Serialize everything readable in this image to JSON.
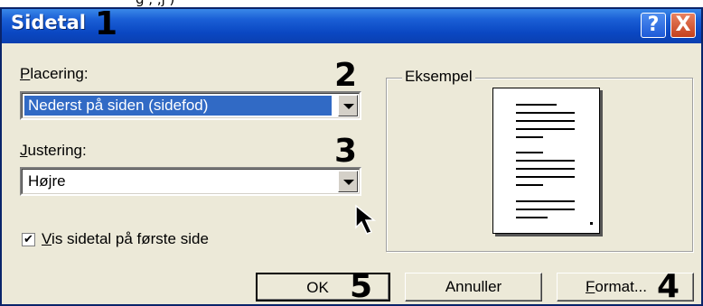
{
  "top_cut_text": "g       ,               ,j                 )",
  "window": {
    "title": "Sidetal",
    "help_label": "?",
    "close_label": "X"
  },
  "callouts": [
    "1",
    "2",
    "3",
    "4",
    "5"
  ],
  "placement": {
    "label_prefix": "P",
    "label_rest": "lacering:",
    "value": "Nederst på siden (sidefod)"
  },
  "alignment": {
    "label_prefix": "J",
    "label_rest": "ustering:",
    "value": "Højre"
  },
  "show_first_page": {
    "checked": true,
    "check_glyph": "✔",
    "label_prefix": "V",
    "label_rest": "is sidetal på første side"
  },
  "preview": {
    "legend": "Eksempel"
  },
  "buttons": {
    "ok": "OK",
    "cancel": "Annuller",
    "format_prefix": "F",
    "format_rest": "ormat..."
  }
}
